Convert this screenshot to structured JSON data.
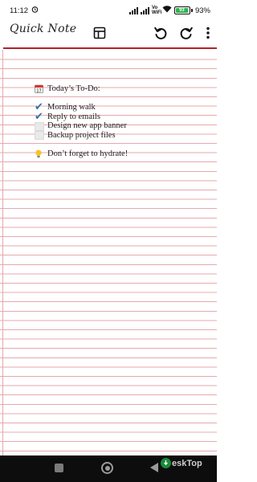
{
  "status_bar": {
    "time": "11:12",
    "network_label": "Vo\nWiFi",
    "battery": "93",
    "battery_pct": "93%",
    "battery_color": "#2db34a"
  },
  "toolbar": {
    "title": "Quick Note",
    "icons": [
      "layout-icon",
      "undo-icon",
      "redo-icon",
      "more-vert-icon"
    ]
  },
  "note": {
    "heading": "Today’s To-Do:",
    "heading_icon": "calendar-icon",
    "items": [
      {
        "text": "Morning walk",
        "done": true
      },
      {
        "text": "Reply to emails",
        "done": true
      },
      {
        "text": "Design new app banner",
        "done": false
      },
      {
        "text": "Backup project files",
        "done": false
      }
    ],
    "reminder": "Don’t forget to hydrate!",
    "reminder_icon": "lightbulb-icon"
  },
  "theme": {
    "rule_color": "#b5202a",
    "line_color": "#e7a8ae",
    "check_color": "#2f6fa9"
  },
  "watermark": {
    "text": "eskTop"
  }
}
